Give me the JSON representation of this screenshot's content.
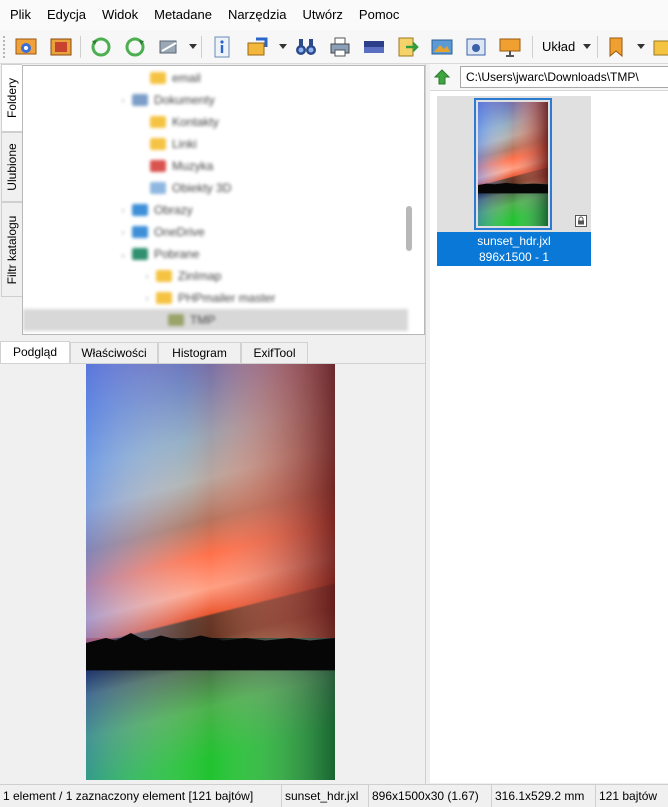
{
  "menu": [
    "Plik",
    "Edycja",
    "Widok",
    "Metadane",
    "Narzędzia",
    "Utwórz",
    "Pomoc"
  ],
  "toolbar": {
    "layout_label": "Układ"
  },
  "left_tabs": [
    "Foldery",
    "Ulubione",
    "Filtr katalogu"
  ],
  "tree": {
    "items": [
      {
        "label": "email",
        "color": "#f5c342",
        "expander": ""
      },
      {
        "label": "Dokumenty",
        "color": "#7d9ec9",
        "expander": "›"
      },
      {
        "label": "Kontakty",
        "color": "#f5c342",
        "expander": ""
      },
      {
        "label": "Linki",
        "color": "#f5c342",
        "expander": ""
      },
      {
        "label": "Muzyka",
        "color": "#d9534f",
        "expander": ""
      },
      {
        "label": "Obiekty 3D",
        "color": "#8fb8e0",
        "expander": ""
      },
      {
        "label": "Obrazy",
        "color": "#3e8fd8",
        "expander": "›"
      },
      {
        "label": "OneDrive",
        "color": "#3e8fd8",
        "expander": "›"
      },
      {
        "label": "Pobrane",
        "color": "#2f8f6f",
        "expander": "⌄"
      },
      {
        "label": "ZinImap",
        "color": "#f5c342",
        "expander": "›"
      },
      {
        "label": "PHPmailer master",
        "color": "#f5c342",
        "expander": "›"
      },
      {
        "label": "TMP",
        "color": "#9aa36a",
        "expander": ""
      }
    ]
  },
  "panel_tabs": [
    "Podgląd",
    "Właściwości",
    "Histogram",
    "ExifTool"
  ],
  "path": {
    "value": "C:\\Users\\jwarc\\Downloads\\TMP\\"
  },
  "thumbnail": {
    "filename": "sunset_hdr.jxl",
    "info": "896x1500 - 1"
  },
  "status": {
    "selection": "1 element / 1 zaznaczony element [121 bajtów]",
    "filename": "sunset_hdr.jxl",
    "dimensions": "896x1500x30 (1.67)",
    "physical_size": "316.1x529.2 mm",
    "file_size": "121 bajtów"
  },
  "colors": {
    "accent": "#0a78d7",
    "selection_border": "#2a7bd1"
  }
}
